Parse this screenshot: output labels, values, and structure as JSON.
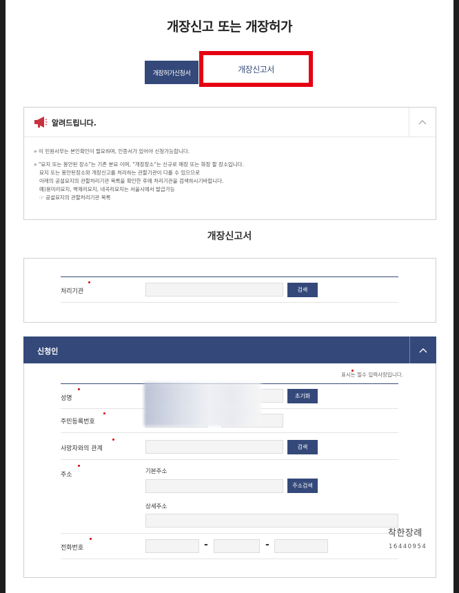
{
  "page": {
    "title": "개장신고 또는 개장허가"
  },
  "tabs": [
    {
      "label": "개장허가신청서",
      "active": false
    },
    {
      "label": "개장신고서",
      "active": true
    }
  ],
  "notice": {
    "title": "알려드립니다.",
    "lines": [
      "» 이 민원사무는 본인확인이 필요하며, 인증서가 있어야 신청가능합니다.",
      "» \"묘지 또는 봉안된 장소\"는 기존 분묘 이며, \"개장장소\"는 신규로 매장 또는 화장 할 장소입니다.",
      "묘지 또는 봉안된장소와 개장신고를 처리하는 관할기관이 다를 수 있으므로",
      "아래의 공설묘지의 관할처리기관 목록을 확인한 후에 처리기관을 검색하시기바랍니다.",
      "예)용미리묘지, 벽제리묘지, 내곡리묘지는 서울시에서 발급가능",
      "☞ 공설묘지의 관할처리기관 목록"
    ]
  },
  "form_heading": "개장신고서",
  "agency": {
    "label": "처리기관",
    "search_button": "검색"
  },
  "applicant": {
    "section_title": "신청인",
    "required_note": "표시는 필수 입력사항입니다.",
    "name_label": "성명",
    "reset_button": "초기화",
    "resident_no_label": "주민등록번호",
    "relation_label": "사망자와의 관계",
    "relation_search_button": "검색",
    "address_label": "주소",
    "basic_address_label": "기본주소",
    "address_search_button": "주소검색",
    "detail_address_label": "상세주소",
    "phone_label": "전화번호",
    "phone_separator": "-"
  },
  "watermark": {
    "name": "착한장례",
    "number": "16440954"
  },
  "colors": {
    "navy": "#34497a",
    "highlight": "#e50012",
    "required": "#d40000"
  }
}
